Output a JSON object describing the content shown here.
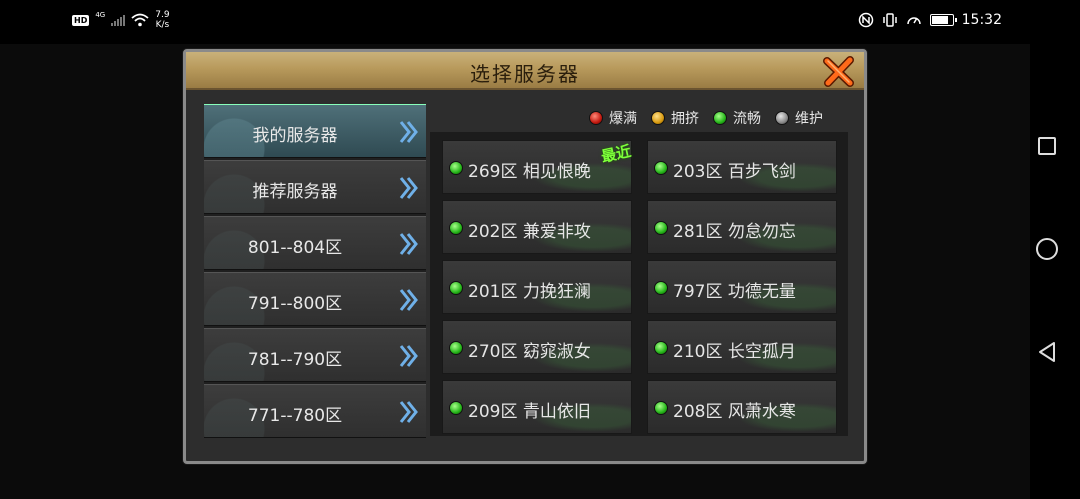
{
  "status_bar": {
    "hd": "HD",
    "network": "4G",
    "speed_value": "7.9",
    "speed_unit": "K/s",
    "time": "15:32",
    "battery_level": 0.85
  },
  "dialog": {
    "title": "选择服务器"
  },
  "menu": {
    "items": [
      {
        "label": "我的服务器",
        "active": true
      },
      {
        "label": "推荐服务器",
        "active": false
      },
      {
        "label": "801--804区",
        "active": false
      },
      {
        "label": "791--800区",
        "active": false
      },
      {
        "label": "781--790区",
        "active": false
      },
      {
        "label": "771--780区",
        "active": false
      }
    ]
  },
  "legend": {
    "full": "爆满",
    "crowded": "拥挤",
    "smooth": "流畅",
    "maintenance": "维护",
    "colors": {
      "full": "#c31a10",
      "crowded": "#d89a10",
      "smooth": "#26b51a",
      "maintenance": "#8a8a8a"
    }
  },
  "servers": [
    {
      "name": "269区 相见恨晚",
      "status": "smooth"
    },
    {
      "name": "203区 百步飞剑",
      "status": "smooth"
    },
    {
      "name": "202区 兼爱非攻",
      "status": "smooth"
    },
    {
      "name": "281区 勿怠勿忘",
      "status": "smooth"
    },
    {
      "name": "201区 力挽狂澜",
      "status": "smooth"
    },
    {
      "name": "797区 功德无量",
      "status": "smooth"
    },
    {
      "name": "270区 窈窕淑女",
      "status": "smooth"
    },
    {
      "name": "210区 长空孤月",
      "status": "smooth"
    },
    {
      "name": "209区 青山依旧",
      "status": "smooth"
    },
    {
      "name": "208区 风萧水寒",
      "status": "smooth"
    }
  ],
  "recent_tag": "最近",
  "icons": {
    "close": "close-x-icon",
    "menu_arrow": "double-chevron-right-icon",
    "wifi": "wifi-icon",
    "battery": "battery-icon"
  }
}
